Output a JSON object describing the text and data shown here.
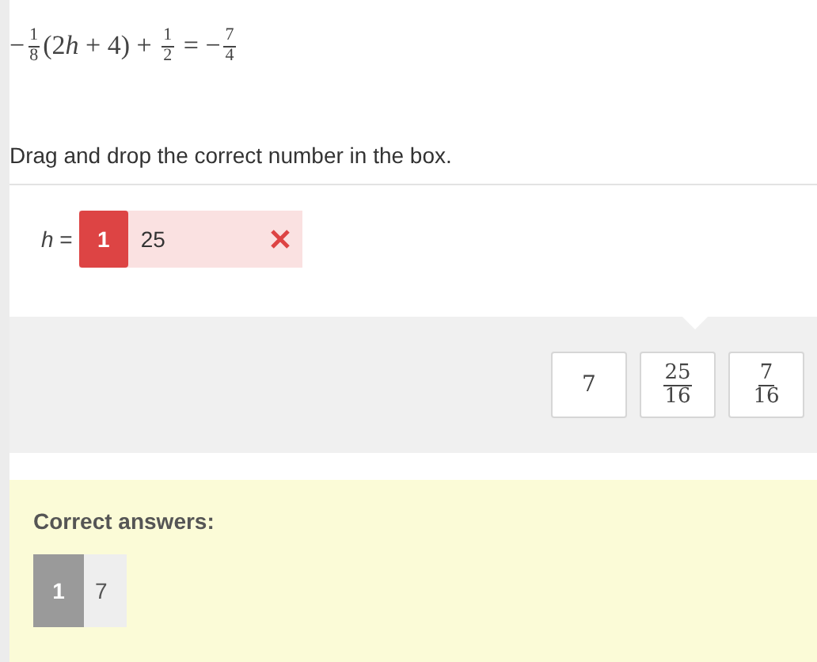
{
  "equation": [
    {
      "kind": "text",
      "text": "−"
    },
    {
      "kind": "frac",
      "num": "1",
      "den": "8"
    },
    {
      "kind": "text",
      "text": "(2"
    },
    {
      "kind": "var",
      "text": "h"
    },
    {
      "kind": "text",
      "text": " + 4) + "
    },
    {
      "kind": "frac",
      "num": "1",
      "den": "2"
    },
    {
      "kind": "text",
      "text": " = −"
    },
    {
      "kind": "frac",
      "num": "7",
      "den": "4"
    }
  ],
  "instruction": "Drag and drop the correct number in the box.",
  "answer": {
    "label": "*h* =",
    "index": "1",
    "value": "25",
    "correct": false
  },
  "options": [
    {
      "kind": "number",
      "text": "7"
    },
    {
      "kind": "frac",
      "num": "25",
      "den": "16"
    },
    {
      "kind": "frac",
      "num": "7",
      "den": "16"
    }
  ],
  "correct_answers": {
    "title": "Correct answers:",
    "items": [
      {
        "index": "1",
        "value": "7"
      }
    ]
  }
}
